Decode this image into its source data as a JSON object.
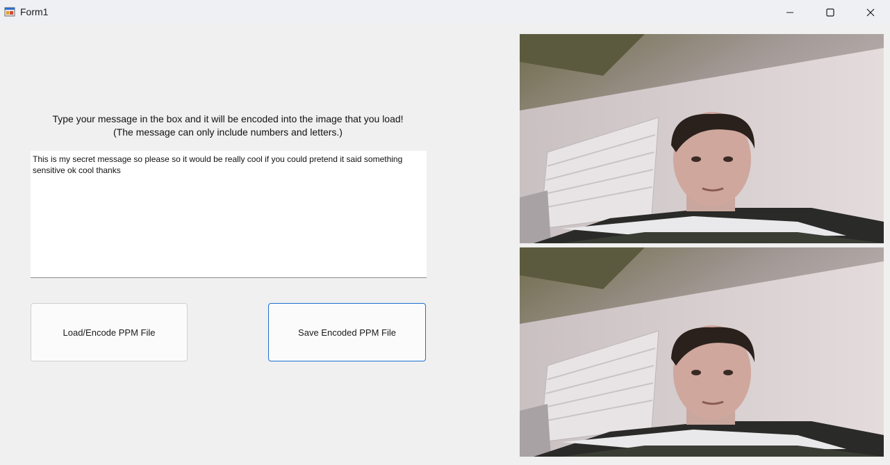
{
  "window": {
    "title": "Form1",
    "icon": "app-form-icon",
    "controls": [
      "minimize-icon",
      "maximize-icon",
      "close-icon"
    ]
  },
  "instructions": {
    "line1": "Type your message in the box and it will be encoded into the image that you load!",
    "line2": "(The message can only include numbers and letters.)"
  },
  "message_box": {
    "value": "This is my secret message so please so it would be really cool if you could pretend it said something sensitive ok cool thanks"
  },
  "buttons": {
    "load_label": "Load/Encode PPM File",
    "save_label": "Save Encoded PPM File"
  },
  "images": {
    "original": "photo-original",
    "encoded": "photo-encoded"
  }
}
